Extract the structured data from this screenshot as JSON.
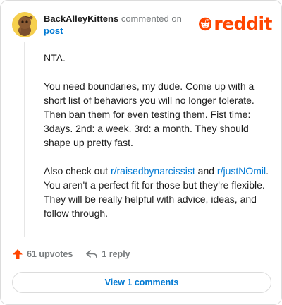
{
  "header": {
    "username": "BackAlleyKittens",
    "commented_text": " commented on",
    "post_link": "post",
    "logo_text": "reddit"
  },
  "comment": {
    "paragraphs": [
      {
        "segments": [
          {
            "text": "NTA."
          }
        ]
      },
      {
        "segments": [
          {
            "text": "You need boundaries, my dude. Come up with a short list of behaviors you will no longer tolerate. Then ban them for even testing them. Fist time: 3days. 2nd: a week. 3rd: a month. They should shape up pretty fast."
          }
        ]
      },
      {
        "segments": [
          {
            "text": "Also check out "
          },
          {
            "text": "r/raisedbynarcissist",
            "link": true
          },
          {
            "text": " and "
          },
          {
            "text": "r/justNOmil",
            "link": true
          },
          {
            "text": ". You aren't a perfect fit for those but they're flexible. They will be really helpful with advice, ideas, and follow through."
          }
        ]
      }
    ]
  },
  "actions": {
    "upvotes_label": "61 upvotes",
    "reply_label": "1 reply"
  },
  "footer": {
    "view_comments_label": "View 1 comments"
  },
  "colors": {
    "brand": "#ff4500",
    "link": "#0079d3",
    "muted": "#787c7e",
    "text": "#1c1c1c"
  },
  "icons": {
    "avatar": "snoo-avatar-icon",
    "logo": "reddit-snoo-icon",
    "upvote": "upvote-arrow-icon",
    "reply": "reply-arrow-icon"
  }
}
